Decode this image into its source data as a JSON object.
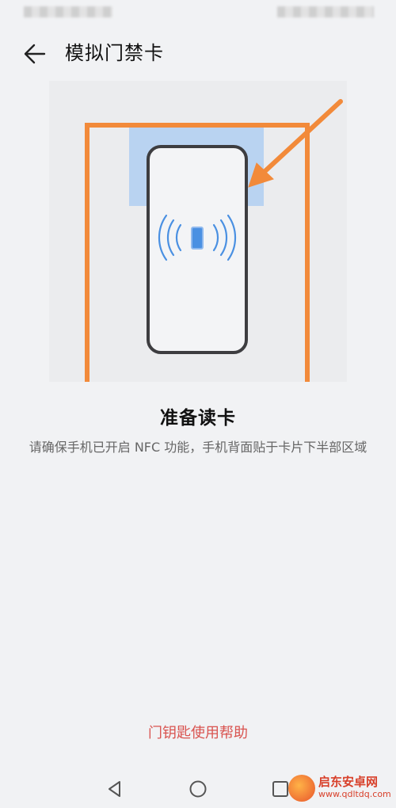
{
  "status_bar": {
    "left": "",
    "right": ""
  },
  "header": {
    "title": "模拟门禁卡"
  },
  "illustration": {
    "accent_color": "#f28a3a",
    "card_color": "#b9d3f1",
    "nfc_color": "#4a90e2"
  },
  "content": {
    "heading": "准备读卡",
    "description": "请确保手机已开启 NFC 功能，手机背面贴于卡片下半部区域"
  },
  "help": {
    "label": "门钥匙使用帮助"
  },
  "nav": {
    "back": "back-triangle",
    "home": "home-circle",
    "recent": "recent-square"
  },
  "watermark": {
    "title": "启东安卓网",
    "url": "www.qdltdq.com"
  }
}
